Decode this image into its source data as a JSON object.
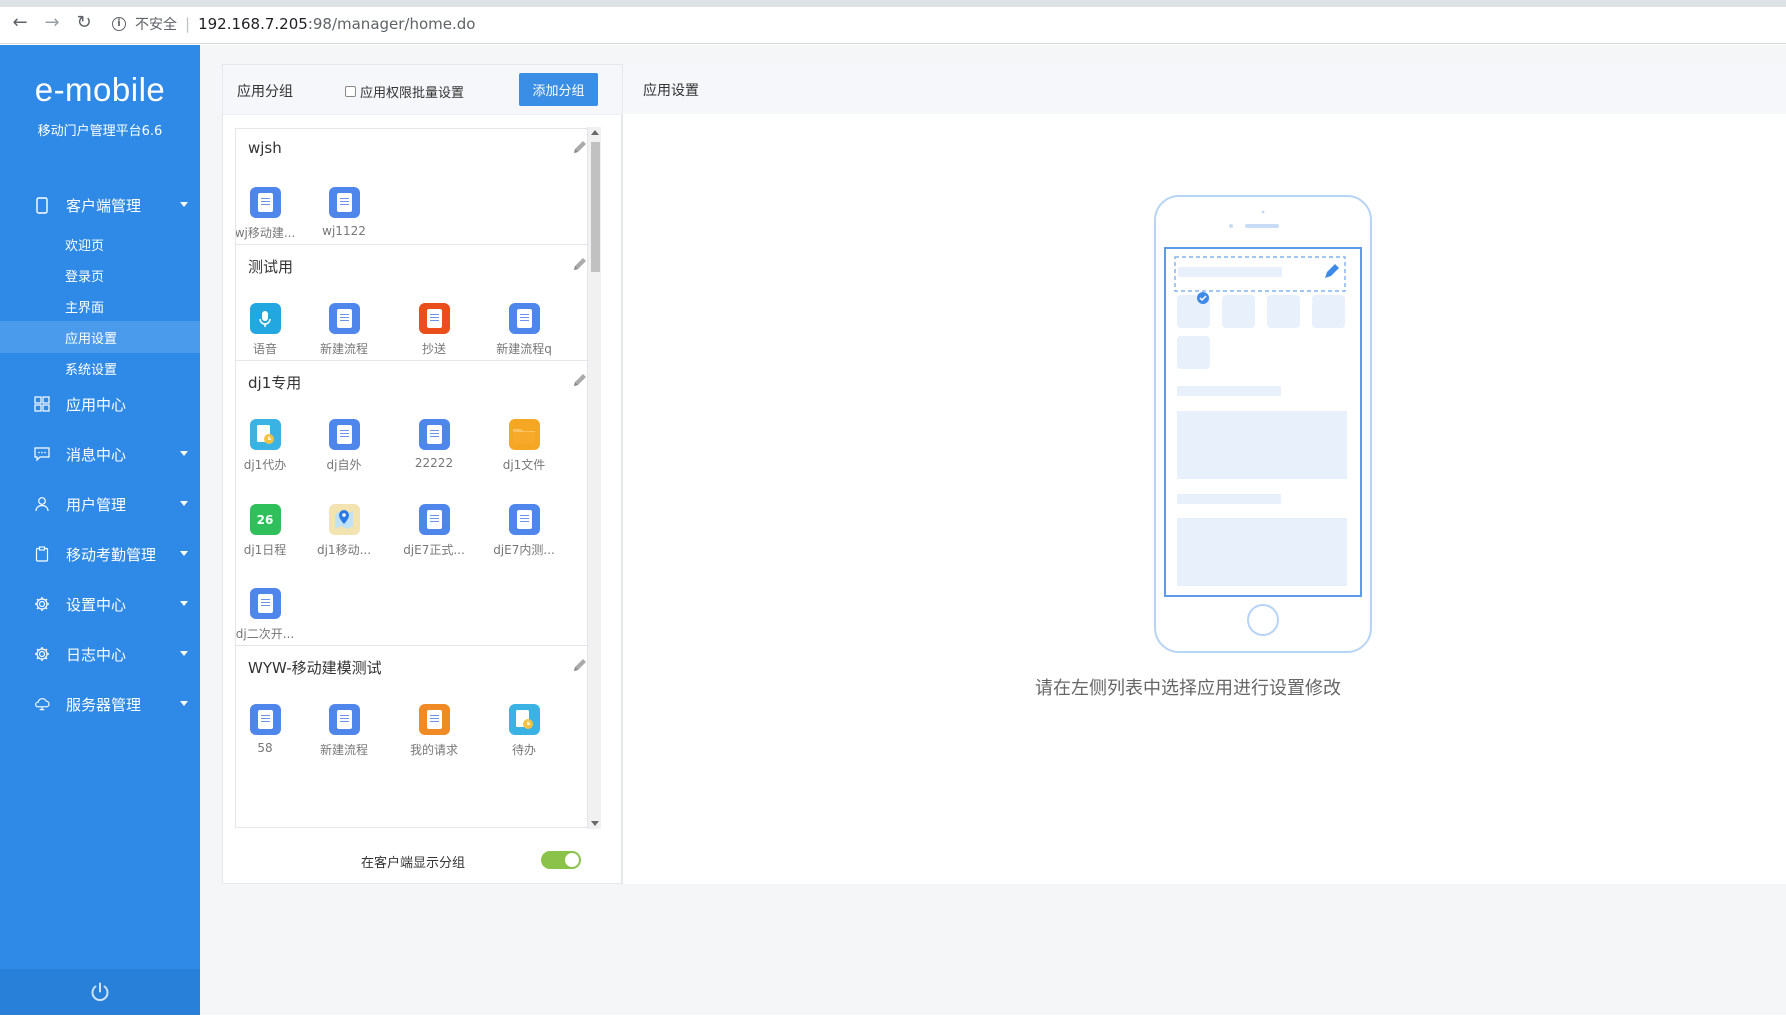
{
  "browser": {
    "insecure_label": "不安全",
    "url_host": "192.168.7.205",
    "url_path": ":98/manager/home.do"
  },
  "sidebar": {
    "logo": "e-mobile",
    "subtitle": "移动门户管理平台6.6",
    "client_mgmt": {
      "label": "客户端管理",
      "children": [
        "欢迎页",
        "登录页",
        "主界面",
        "应用设置",
        "系统设置"
      ],
      "active": "应用设置"
    },
    "items": [
      {
        "label": "应用中心",
        "icon": "app-center-icon",
        "has_caret": false
      },
      {
        "label": "消息中心",
        "icon": "message-icon",
        "has_caret": true
      },
      {
        "label": "用户管理",
        "icon": "user-icon",
        "has_caret": true
      },
      {
        "label": "移动考勤管理",
        "icon": "clipboard-icon",
        "has_caret": true
      },
      {
        "label": "设置中心",
        "icon": "gear-icon",
        "has_caret": true
      },
      {
        "label": "日志中心",
        "icon": "gear-icon",
        "has_caret": true
      },
      {
        "label": "服务器管理",
        "icon": "cloud-icon",
        "has_caret": true
      }
    ],
    "power_icon": "power-icon"
  },
  "left_panel": {
    "title": "应用分组",
    "batch_checkbox_label": "应用权限批量设置",
    "batch_checked": false,
    "add_button": "添加分组",
    "groups": [
      {
        "name": "wjsh",
        "apps": [
          {
            "label": "wj移动建...",
            "icon": "doc-icon",
            "color": "#4f86ec"
          },
          {
            "label": "wj1122",
            "icon": "doc-icon",
            "color": "#4f86ec"
          }
        ]
      },
      {
        "name": "测试用",
        "apps": [
          {
            "label": "语音",
            "icon": "microphone-icon",
            "color": "#22a7e0"
          },
          {
            "label": "新建流程",
            "icon": "doc-icon",
            "color": "#4f86ec"
          },
          {
            "label": "抄送",
            "icon": "doc-icon",
            "color": "#e94e1b"
          },
          {
            "label": "新建流程q",
            "icon": "doc-icon",
            "color": "#4f86ec"
          }
        ]
      },
      {
        "name": "dj1专用",
        "apps": [
          {
            "label": "dj1代办",
            "icon": "clock-doc-icon",
            "color": "#3bb2e4"
          },
          {
            "label": "dj自外",
            "icon": "doc-icon",
            "color": "#4f86ec"
          },
          {
            "label": "22222",
            "icon": "doc-icon",
            "color": "#4f86ec"
          },
          {
            "label": "dj1文件",
            "icon": "folder-icon",
            "color": "#f5a623"
          },
          {
            "label": "dj1日程",
            "icon": "calendar-icon",
            "color": "#2fbf5b",
            "badge": "26"
          },
          {
            "label": "dj1移动...",
            "icon": "map-pin-icon",
            "color": "#f0c060"
          },
          {
            "label": "djE7正式...",
            "icon": "doc-icon",
            "color": "#4f86ec"
          },
          {
            "label": "djE7内测...",
            "icon": "doc-icon",
            "color": "#4f86ec"
          },
          {
            "label": "dj二次开...",
            "icon": "doc-icon",
            "color": "#4f86ec"
          }
        ]
      },
      {
        "name": "WYW-移动建模测试",
        "apps": [
          {
            "label": "58",
            "icon": "doc-icon",
            "color": "#4f86ec"
          },
          {
            "label": "新建流程",
            "icon": "doc-icon",
            "color": "#4f86ec"
          },
          {
            "label": "我的请求",
            "icon": "doc-icon",
            "color": "#f08a24"
          },
          {
            "label": "待办",
            "icon": "clock-doc-icon",
            "color": "#3bb2e4"
          }
        ]
      }
    ],
    "show_group_label": "在客户端显示分组",
    "show_group_enabled": true
  },
  "right_panel": {
    "title": "应用设置",
    "hint": "请在左侧列表中选择应用进行设置修改"
  }
}
